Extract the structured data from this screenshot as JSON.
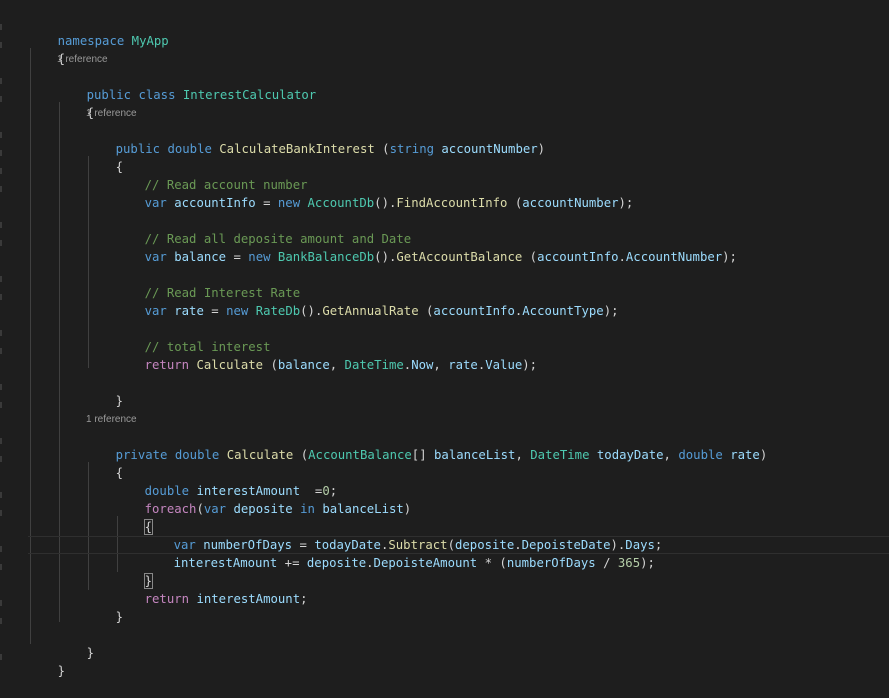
{
  "codelens": {
    "class_refs": "1 reference",
    "method1_refs": "1 reference",
    "method2_refs": "1 reference"
  },
  "lines": {
    "l01": [
      "namespace",
      " ",
      "MyApp"
    ],
    "l02": [
      "{"
    ],
    "l03": [
      "public",
      " ",
      "class",
      " ",
      "InterestCalculator"
    ],
    "l04": [
      "{"
    ],
    "l05": [
      "public",
      " ",
      "double",
      " ",
      "CalculateBankInterest",
      " (",
      "string",
      " ",
      "accountNumber",
      ")"
    ],
    "l06": [
      "{"
    ],
    "l07": [
      "// Read account number"
    ],
    "l08": [
      "var",
      " ",
      "accountInfo",
      " = ",
      "new",
      " ",
      "AccountDb",
      "().",
      "FindAccountInfo",
      " (",
      "accountNumber",
      ");"
    ],
    "l09": [
      "// Read all deposite amount and Date"
    ],
    "l10": [
      "var",
      " ",
      "balance",
      " = ",
      "new",
      " ",
      "BankBalanceDb",
      "().",
      "GetAccountBalance",
      " (",
      "accountInfo",
      ".",
      "AccountNumber",
      ");"
    ],
    "l11": [
      "// Read Interest Rate"
    ],
    "l12": [
      "var",
      " ",
      "rate",
      " = ",
      "new",
      " ",
      "RateDb",
      "().",
      "GetAnnualRate",
      " (",
      "accountInfo",
      ".",
      "AccountType",
      ");"
    ],
    "l13": [
      "// total interest"
    ],
    "l14": [
      "return",
      " ",
      "Calculate",
      " (",
      "balance",
      ", ",
      "DateTime",
      ".",
      "Now",
      ", ",
      "rate",
      ".",
      "Value",
      ");"
    ],
    "l15": [
      "}"
    ],
    "l16": [
      "private",
      " ",
      "double",
      " ",
      "Calculate",
      " (",
      "AccountBalance",
      "[] ",
      "balanceList",
      ", ",
      "DateTime",
      " ",
      "todayDate",
      ", ",
      "double",
      " ",
      "rate",
      ")"
    ],
    "l17": [
      "{"
    ],
    "l18": [
      "double",
      " ",
      "interestAmount",
      "  =",
      "0",
      ";"
    ],
    "l19": [
      "foreach",
      "(",
      "var",
      " ",
      "deposite",
      " ",
      "in",
      " ",
      "balanceList",
      ")"
    ],
    "l20": [
      "{"
    ],
    "l21": [
      "var",
      " ",
      "numberOfDays",
      " = ",
      "todayDate",
      ".",
      "Subtract",
      "(",
      "deposite",
      ".",
      "DepoisteDate",
      ").",
      "Days",
      ";"
    ],
    "l22": [
      "interestAmount",
      " += ",
      "deposite",
      ".",
      "DepoisteAmount",
      " * (",
      "numberOfDays",
      " / ",
      "365",
      ");"
    ],
    "l23": [
      "}"
    ],
    "l24": [
      "return",
      " ",
      "interestAmount",
      ";"
    ],
    "l25": [
      "}"
    ],
    "l26": [
      "}"
    ],
    "l27": [
      "}"
    ]
  },
  "theme": {
    "background": "#1e1e1e",
    "keyword": "#569cd6",
    "control": "#c586c0",
    "type": "#4ec9b0",
    "function": "#dcdcaa",
    "variable": "#9cdcfe",
    "comment": "#6a9955",
    "number": "#b5cea8"
  }
}
